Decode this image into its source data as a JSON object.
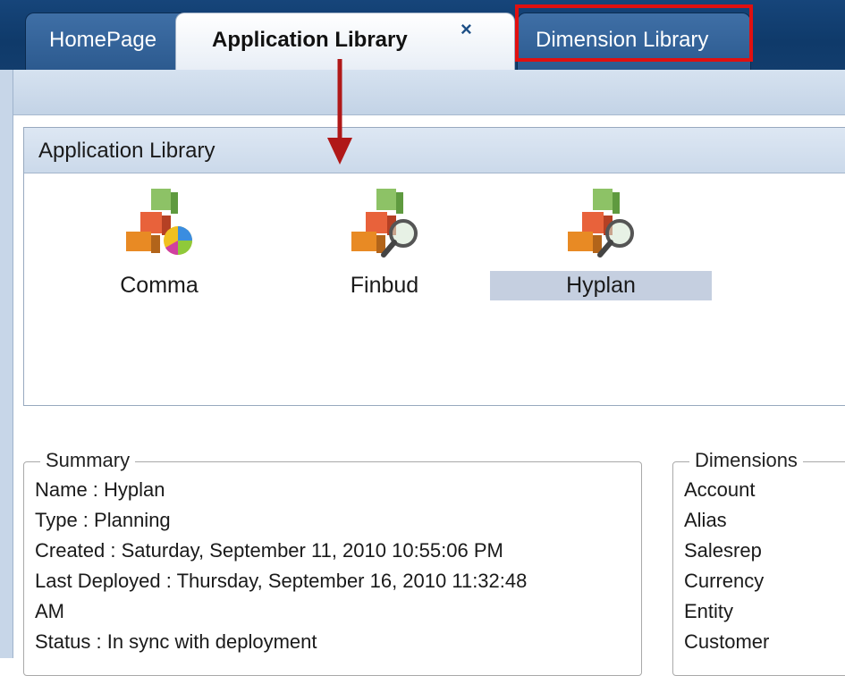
{
  "tabs": {
    "homepage": "HomePage",
    "application_library": "Application Library",
    "application_library_close": "×",
    "dimension_library": "Dimension Library"
  },
  "app_library": {
    "header": "Application Library",
    "apps": [
      {
        "label": "Comma",
        "icon": "application-cube-piechart-icon"
      },
      {
        "label": "Finbud",
        "icon": "application-cube-magnifier-icon"
      },
      {
        "label": "Hyplan",
        "icon": "application-cube-magnifier-icon",
        "selected": true
      }
    ]
  },
  "summary": {
    "legend": "Summary",
    "lines": [
      "Name : Hyplan",
      "Type : Planning",
      "Created : Saturday, September 11, 2010 10:55:06 PM",
      "Last Deployed : Thursday, September 16, 2010 11:32:48",
      "AM",
      "Status : In sync with deployment"
    ]
  },
  "dimensions": {
    "legend": "Dimensions",
    "items": [
      "Account",
      "Alias",
      "Salesrep",
      "Currency",
      "Entity",
      "Customer"
    ]
  },
  "annotation": {
    "highlight_color": "#e01010",
    "arrow_color": "#b01818"
  }
}
